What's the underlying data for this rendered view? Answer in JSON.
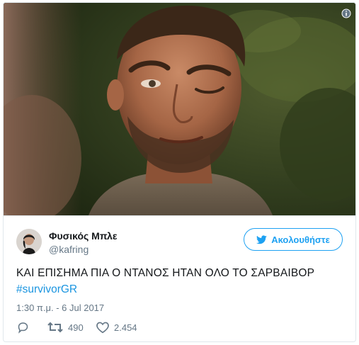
{
  "tweet": {
    "author": {
      "name": "Φυσικός Μπλε",
      "handle": "@kafring"
    },
    "follow_label": "Ακολουθήστε",
    "text": "ΚΑΙ ΕΠΙΣΗΜΑ ΠΙΑ Ο ΝΤΑΝΟΣ ΗΤΑΝ ΟΛΟ ΤΟ ΣΑΡΒΑΙΒΟΡ",
    "hashtag": "#survivorGR",
    "timestamp": "1:30 π.μ. - 6 Jul 2017",
    "stats": {
      "retweets": "490",
      "likes": "2.454"
    }
  },
  "icons": {
    "info": "info-icon",
    "follow": "twitter-bird-icon",
    "reply": "reply-icon",
    "retweet": "retweet-icon",
    "like": "heart-icon"
  },
  "colors": {
    "twitter_blue": "#1da1f2",
    "link": "#1b95e0",
    "secondary_text": "#657786",
    "border": "#e1e8ed"
  }
}
